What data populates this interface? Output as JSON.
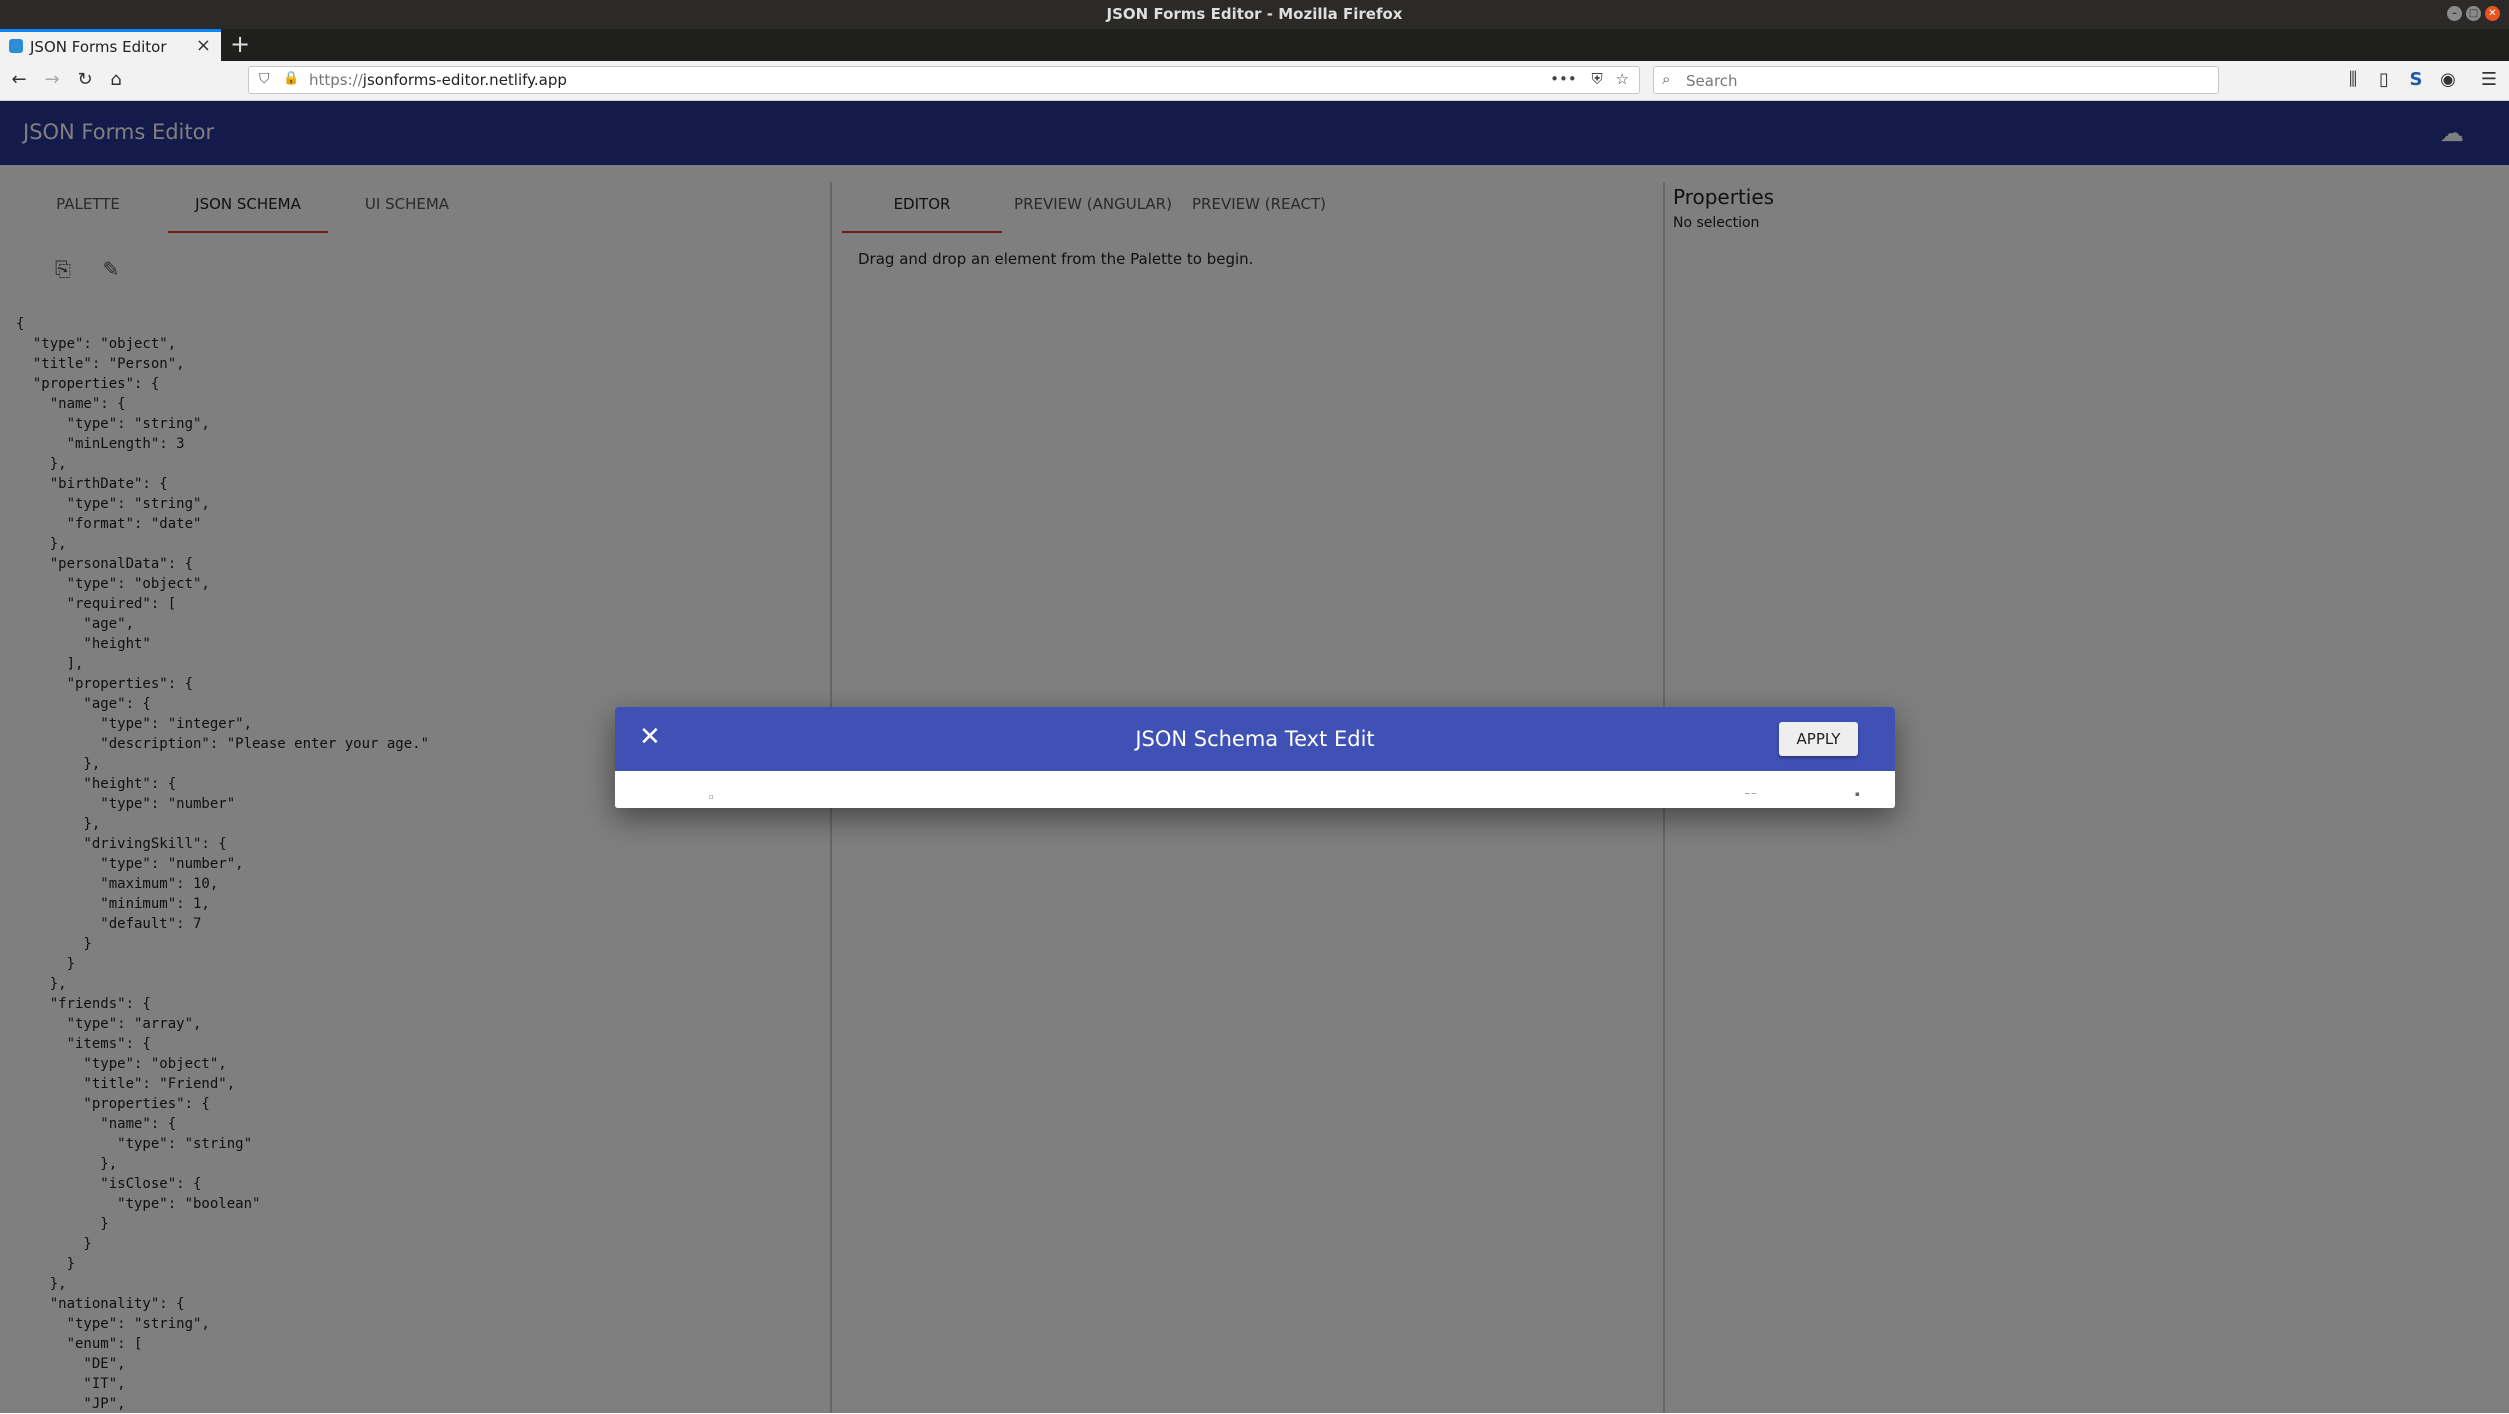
{
  "window": {
    "title": "JSON Forms Editor - Mozilla Firefox"
  },
  "browser": {
    "tab_label": "JSON Forms Editor",
    "url_protocol": "https://",
    "url_host": "jsonforms-editor.netlify.app",
    "search_placeholder": "Search"
  },
  "app": {
    "title": "JSON Forms Editor",
    "left_tabs": [
      "PALETTE",
      "JSON SCHEMA",
      "UI SCHEMA"
    ],
    "center_tabs": [
      "EDITOR",
      "PREVIEW (ANGULAR)",
      "PREVIEW (REACT)"
    ],
    "editor_hint": "Drag and drop an element from the Palette to begin.",
    "properties_title": "Properties",
    "properties_subtitle": "No selection",
    "schema_text": "{\n  \"type\": \"object\",\n  \"title\": \"Person\",\n  \"properties\": {\n    \"name\": {\n      \"type\": \"string\",\n      \"minLength\": 3\n    },\n    \"birthDate\": {\n      \"type\": \"string\",\n      \"format\": \"date\"\n    },\n    \"personalData\": {\n      \"type\": \"object\",\n      \"required\": [\n        \"age\",\n        \"height\"\n      ],\n      \"properties\": {\n        \"age\": {\n          \"type\": \"integer\",\n          \"description\": \"Please enter your age.\"\n        },\n        \"height\": {\n          \"type\": \"number\"\n        },\n        \"drivingSkill\": {\n          \"type\": \"number\",\n          \"maximum\": 10,\n          \"minimum\": 1,\n          \"default\": 7\n        }\n      }\n    },\n    \"friends\": {\n      \"type\": \"array\",\n      \"items\": {\n        \"type\": \"object\",\n        \"title\": \"Friend\",\n        \"properties\": {\n          \"name\": {\n            \"type\": \"string\"\n          },\n          \"isClose\": {\n            \"type\": \"boolean\"\n          }\n        }\n      }\n    },\n    \"nationality\": {\n      \"type\": \"string\",\n      \"enum\": [\n        \"DE\",\n        \"IT\",\n        \"JP\","
  },
  "dialog": {
    "title": "JSON Schema Text Edit",
    "apply_label": "APPLY"
  },
  "colors": {
    "appbar": "#283593",
    "dialog_bar": "#3f51b5",
    "tab_indicator": "#e53935"
  },
  "icons": {
    "close": "close-icon",
    "copy": "copy-icon",
    "edit": "pencil-icon",
    "cloud": "cloud-download-icon"
  }
}
